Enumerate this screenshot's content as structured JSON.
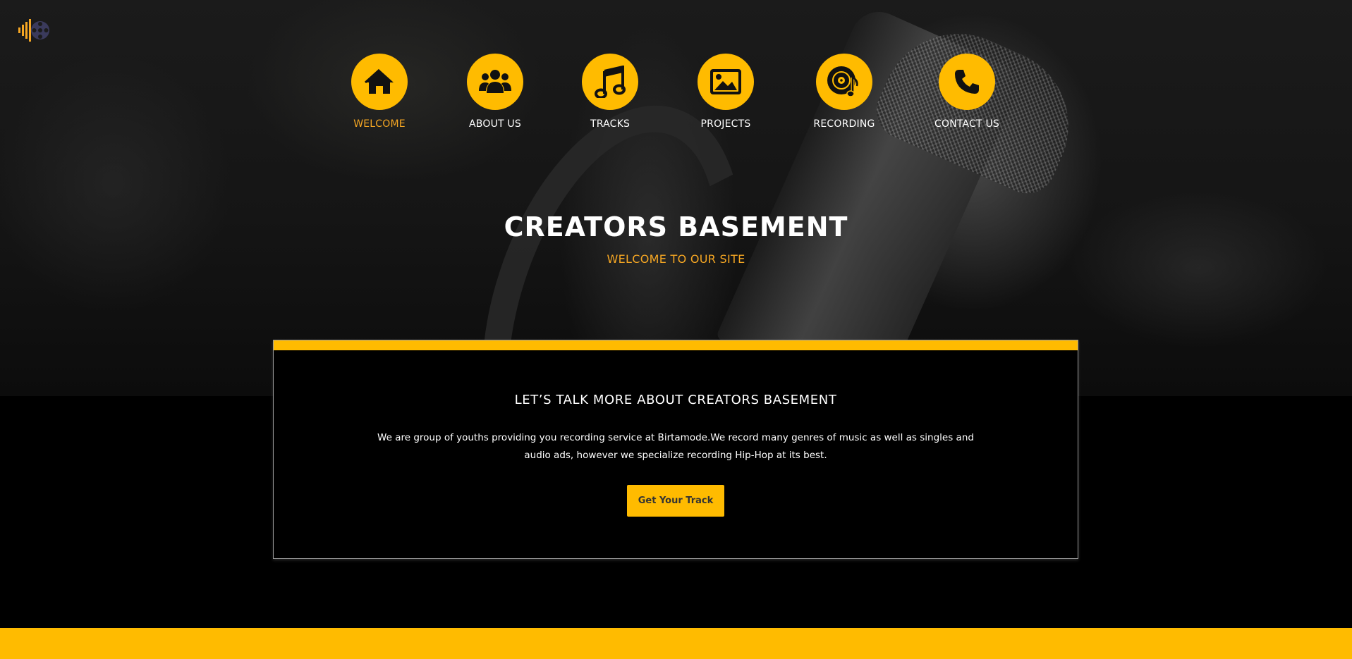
{
  "brand": {
    "logo_icon": "waveform-film-reel-icon",
    "accent_color": "#ffbb00",
    "highlight_color": "#f5a623"
  },
  "nav": {
    "items": [
      {
        "label": "WELCOME",
        "icon": "home-icon",
        "active": true
      },
      {
        "label": "ABOUT US",
        "icon": "users-icon",
        "active": false
      },
      {
        "label": "TRACKS",
        "icon": "music-note-icon",
        "active": false
      },
      {
        "label": "PROJECTS",
        "icon": "image-icon",
        "active": false
      },
      {
        "label": "RECORDING",
        "icon": "vinyl-music-icon",
        "active": false
      },
      {
        "label": "CONTACT US",
        "icon": "phone-icon",
        "active": false
      }
    ]
  },
  "hero": {
    "title": "CREATORS BASEMENT",
    "subtitle": "WELCOME TO OUR SITE"
  },
  "about": {
    "heading": "LET’S TALK MORE ABOUT CREATORS BASEMENT",
    "body": "We are group of youths providing you recording service at Birtamode.We record many genres of music as well as singles and audio ads, however we specialize recording Hip-Hop at its best.",
    "button_label": "Get Your Track"
  }
}
